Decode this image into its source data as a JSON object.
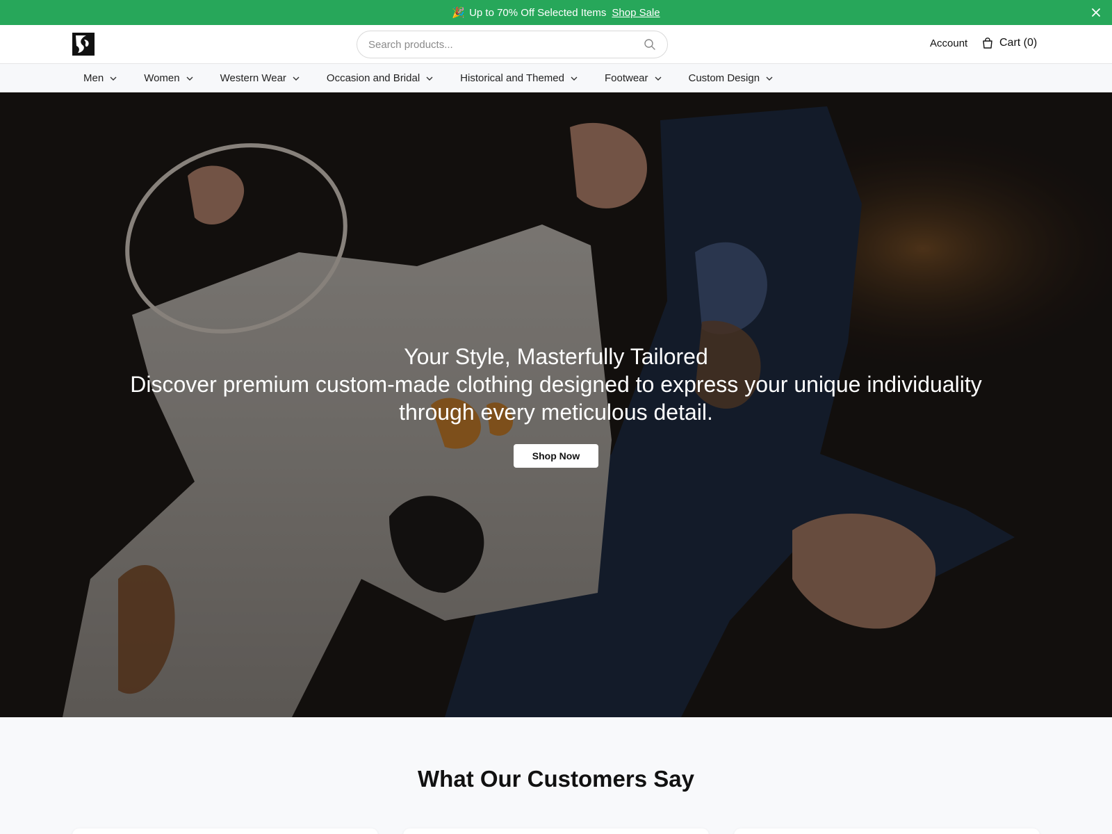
{
  "promo": {
    "emoji": "🎉",
    "text": "Up to 70% Off Selected Items",
    "link": "Shop Sale",
    "close_icon": "close-icon",
    "background": "#27a75a"
  },
  "header": {
    "logo_icon": "brand-logo-icon",
    "search": {
      "placeholder": "Search products...",
      "value": "",
      "icon": "search-icon"
    },
    "account_label": "Account",
    "cart_label": "Cart (0)",
    "cart_icon": "shopping-bag-icon"
  },
  "nav": {
    "items": [
      {
        "label": "Men"
      },
      {
        "label": "Women"
      },
      {
        "label": "Western Wear"
      },
      {
        "label": "Occasion and Bridal"
      },
      {
        "label": "Historical and Themed"
      },
      {
        "label": "Footwear"
      },
      {
        "label": "Custom Design"
      }
    ],
    "chevron_icon": "chevron-down-icon"
  },
  "hero": {
    "title": "Your Style, Masterfully Tailored",
    "subtitle": "Discover premium custom-made clothing designed to express your unique individuality through every meticulous detail.",
    "button_label": "Shop Now"
  },
  "testimonials": {
    "heading": "What Our Customers Say"
  }
}
